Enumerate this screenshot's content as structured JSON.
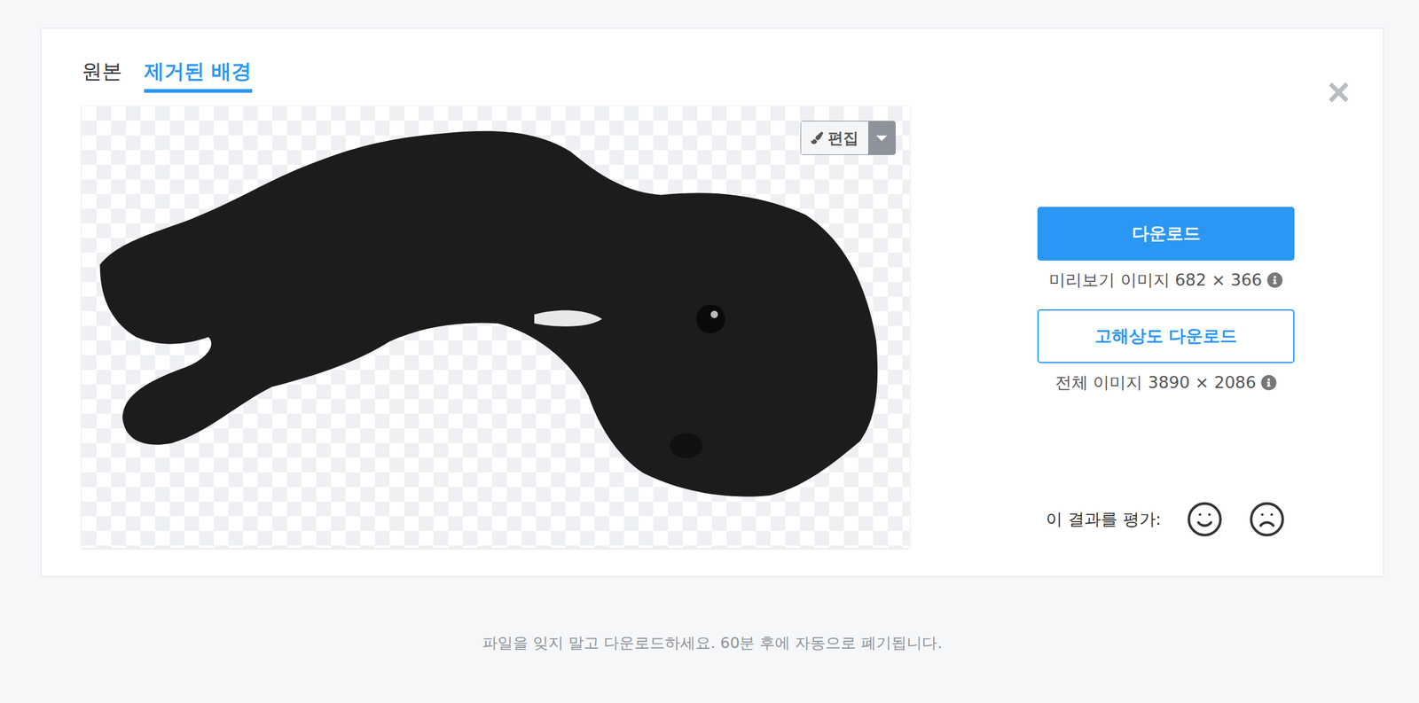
{
  "tabs": [
    {
      "label": "원본",
      "selected": false
    },
    {
      "label": "제거된 배경",
      "selected": true
    }
  ],
  "close": "×",
  "edit": {
    "label": "편집"
  },
  "downloads": [
    {
      "label": "다운로드",
      "primary": true,
      "caption": "미리보기 이미지 682 × 366"
    },
    {
      "label": "고해상도 다운로드",
      "primary": false,
      "caption": "전체 이미지 3890 × 2086"
    }
  ],
  "rating": {
    "label": "이 결과를 평가:"
  },
  "footer": "파일을 잊지 말고 다운로드하세요. 60분 후에 자동으로 폐기됩니다."
}
